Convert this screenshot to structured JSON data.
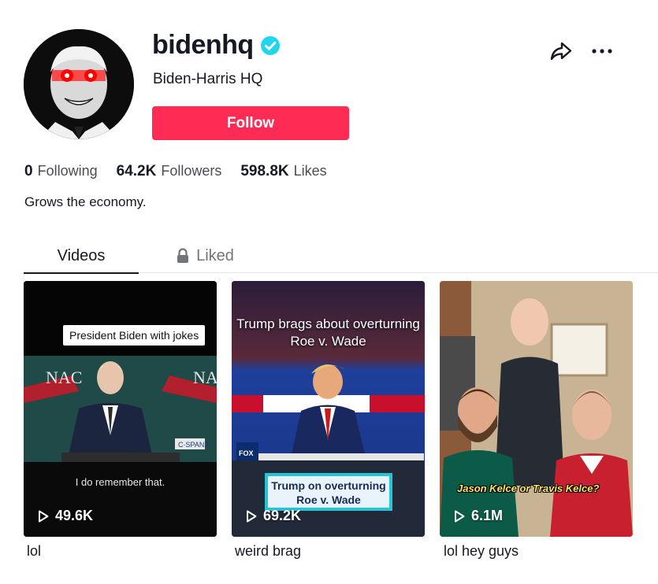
{
  "profile": {
    "username": "bidenhq",
    "display_name": "Biden-Harris HQ",
    "follow_label": "Follow",
    "bio": "Grows the economy.",
    "verified_icon": "verified-badge-icon",
    "accent_color": "#fe2c55",
    "verified_color": "#20d5ec"
  },
  "stats": {
    "following": {
      "value": "0",
      "label": "Following"
    },
    "followers": {
      "value": "64.2K",
      "label": "Followers"
    },
    "likes": {
      "value": "598.8K",
      "label": "Likes"
    }
  },
  "tabs": [
    {
      "label": "Videos",
      "active": true
    },
    {
      "label": "Liked",
      "icon": "lock-icon",
      "active": false
    }
  ],
  "videos": [
    {
      "views": "49.6K",
      "caption": "lol",
      "overlay_title": "President Biden with jokes",
      "overlay_subtitle": "I do remember that."
    },
    {
      "views": "69.2K",
      "caption": "weird brag",
      "overlay_title": "Trump brags about overturning Roe v. Wade",
      "overlay_lower_third": "Trump on overturning Roe v. Wade"
    },
    {
      "views": "6.1M",
      "caption": "lol hey guys",
      "overlay_title": "Jason Kelce or Travis Kelce?"
    }
  ]
}
